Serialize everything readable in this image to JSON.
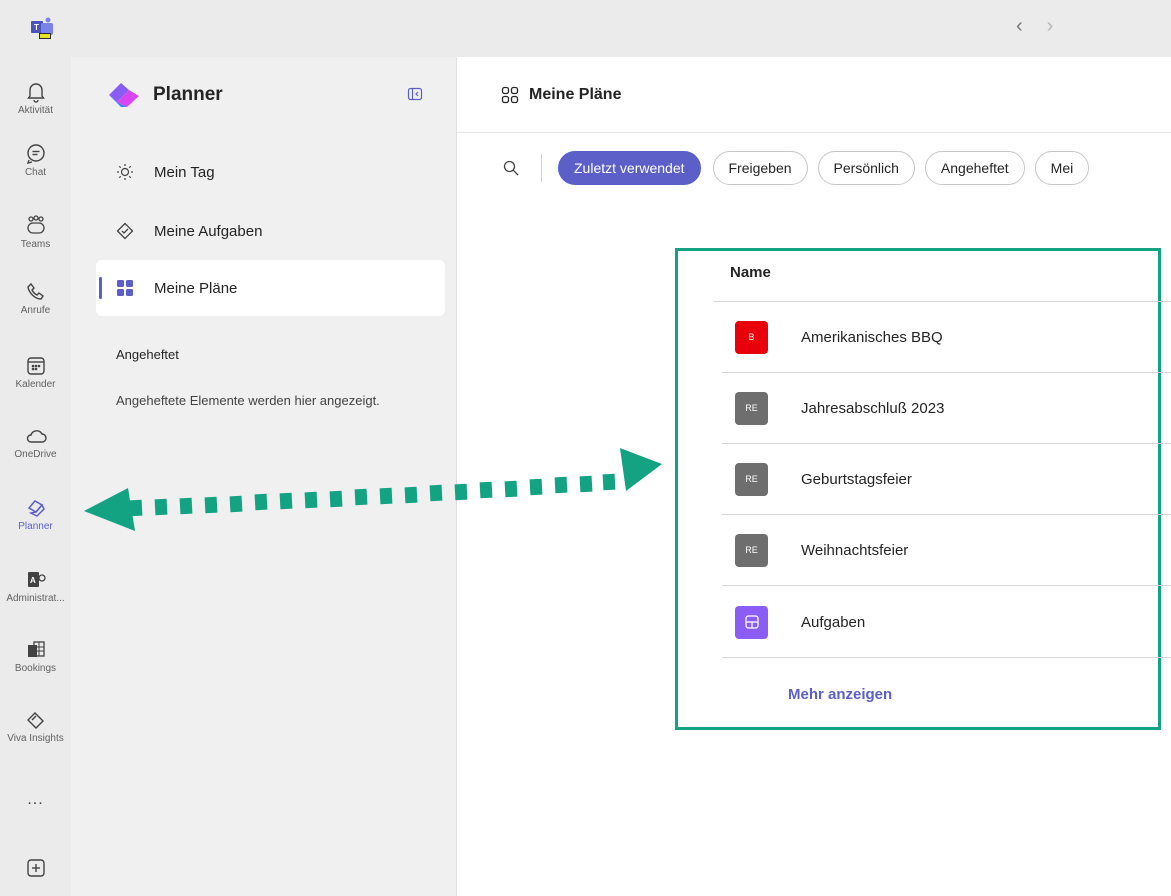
{
  "titlebar": {
    "back_icon": "chevron-left-icon",
    "forward_icon": "chevron-right-icon"
  },
  "rail": {
    "items": [
      {
        "label": "Aktivität",
        "icon": "bell-icon"
      },
      {
        "label": "Chat",
        "icon": "chat-icon"
      },
      {
        "label": "Teams",
        "icon": "teams-icon"
      },
      {
        "label": "Anrufe",
        "icon": "phone-icon"
      },
      {
        "label": "Kalender",
        "icon": "calendar-icon"
      },
      {
        "label": "OneDrive",
        "icon": "cloud-icon"
      },
      {
        "label": "Planner",
        "icon": "planner-icon"
      },
      {
        "label": "Administrat...",
        "icon": "admin-icon"
      },
      {
        "label": "Bookings",
        "icon": "bookings-icon"
      },
      {
        "label": "Viva Insights",
        "icon": "insights-icon"
      }
    ],
    "more_label": "...",
    "add_icon": "plus-square-icon"
  },
  "panel": {
    "title": "Planner",
    "nav": [
      {
        "label": "Mein Tag",
        "icon": "sun-icon"
      },
      {
        "label": "Meine Aufgaben",
        "icon": "task-check-icon"
      },
      {
        "label": "Meine Pläne",
        "icon": "grid-icon"
      }
    ],
    "pinned_title": "Angeheftet",
    "pinned_desc": "Angeheftete Elemente werden hier angezeigt."
  },
  "main": {
    "title": "Meine Pläne",
    "filters": [
      "Zuletzt verwendet",
      "Freigeben",
      "Persönlich",
      "Angeheftet",
      "Mei"
    ],
    "selected_filter": "Zuletzt verwendet",
    "list_header": "Name",
    "rows": [
      {
        "badge": "B",
        "name": "Amerikanisches BBQ",
        "color": "#e8000b"
      },
      {
        "badge": "RE",
        "name": "Jahresabschluß 2023",
        "color": "#6e6e6e"
      },
      {
        "badge": "RE",
        "name": "Geburtstagsfeier",
        "color": "#6e6e6e"
      },
      {
        "badge": "RE",
        "name": "Weihnachtsfeier",
        "color": "#6e6e6e"
      },
      {
        "badge": "",
        "name": "Aufgaben",
        "color": "#8b5cf6"
      }
    ],
    "more_label": "Mehr anzeigen"
  },
  "colors": {
    "accent": "#5b5fc7",
    "highlight": "#13a383"
  }
}
